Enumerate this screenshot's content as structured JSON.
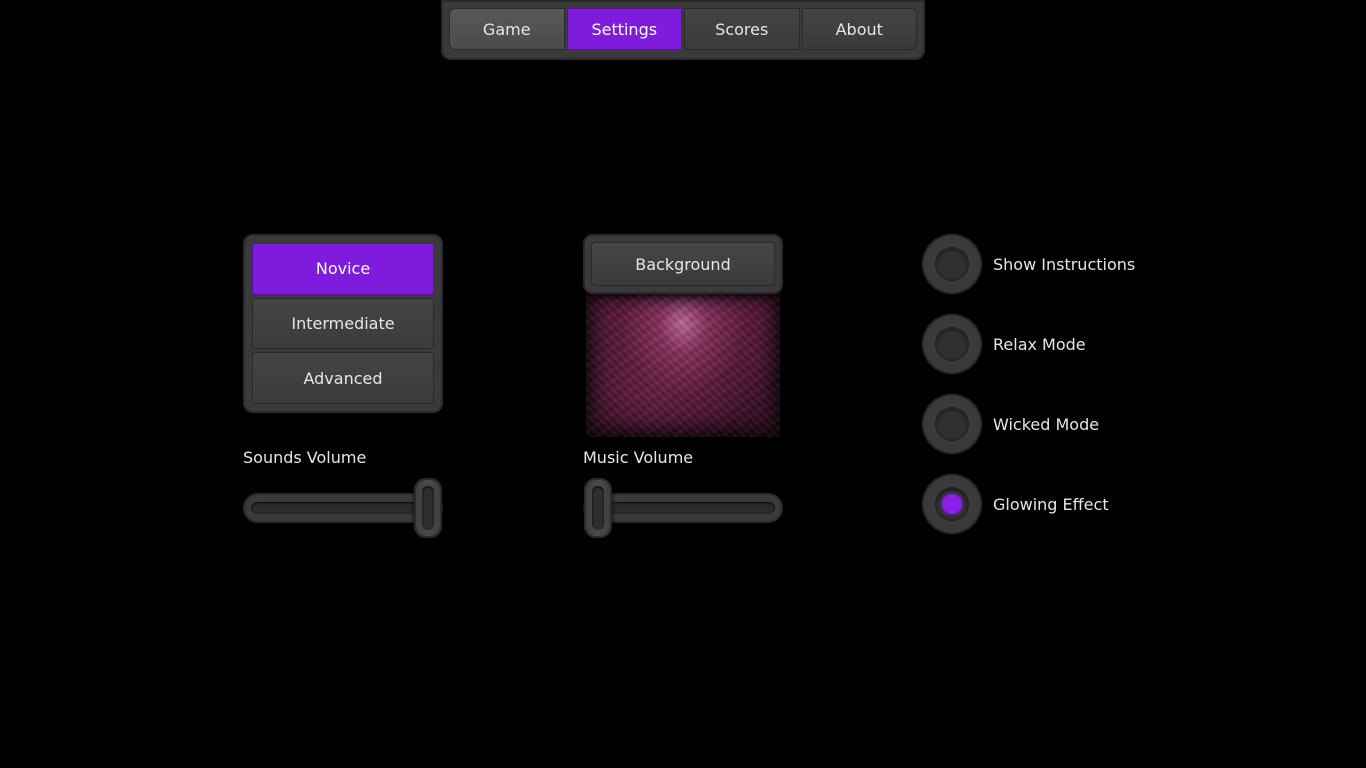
{
  "nav": {
    "tabs": [
      {
        "label": "Game",
        "active": false
      },
      {
        "label": "Settings",
        "active": true
      },
      {
        "label": "Scores",
        "active": false
      },
      {
        "label": "About",
        "active": false
      }
    ]
  },
  "difficulty": {
    "options": [
      "Novice",
      "Intermediate",
      "Advanced"
    ],
    "selected": "Novice"
  },
  "background": {
    "button_label": "Background"
  },
  "sounds_volume": {
    "label": "Sounds Volume",
    "value_fraction": 1.0
  },
  "music_volume": {
    "label": "Music Volume",
    "value_fraction": 0.0
  },
  "toggles": [
    {
      "label": "Show Instructions",
      "checked": false
    },
    {
      "label": "Relax Mode",
      "checked": false
    },
    {
      "label": "Wicked Mode",
      "checked": false
    },
    {
      "label": "Glowing Effect",
      "checked": true
    }
  ],
  "colors": {
    "accent": "#7f1bdc",
    "panel": "#3a3a3a",
    "background": "#000000"
  }
}
